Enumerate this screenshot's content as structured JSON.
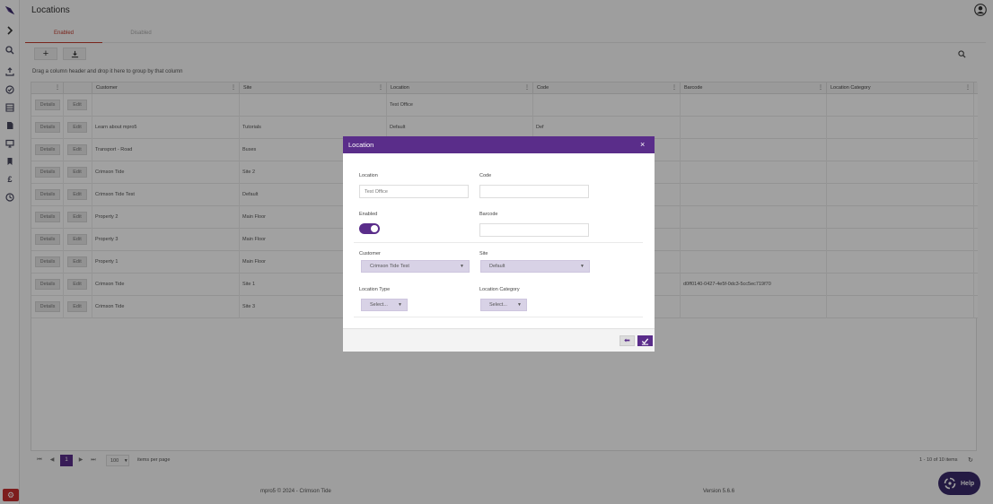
{
  "app": {
    "page_title": "Locations",
    "colors": {
      "accent": "#5a2d8a",
      "danger": "#c62f2f",
      "tab_active": "#c0392b"
    }
  },
  "sidebar": {
    "items": [
      {
        "icon": "logo-icon"
      },
      {
        "icon": "chevron-right-icon"
      },
      {
        "icon": "search-icon"
      },
      {
        "icon": "upload-icon"
      },
      {
        "icon": "check-circle-icon"
      },
      {
        "icon": "list-icon"
      },
      {
        "icon": "document-icon"
      },
      {
        "icon": "monitor-icon"
      },
      {
        "icon": "bookmark-icon"
      },
      {
        "icon": "pound-icon"
      },
      {
        "icon": "clock-icon"
      }
    ],
    "settings_icon": "gear-icon"
  },
  "tabs": [
    {
      "label": "Enabled",
      "active": true
    },
    {
      "label": "Disabled",
      "active": false
    }
  ],
  "grid": {
    "group_hint": "Drag a column header and drop it here to group by that column",
    "columns": [
      "Customer",
      "Site",
      "Location",
      "Code",
      "Barcode",
      "Location Category"
    ],
    "details_label": "Details",
    "edit_label": "Edit",
    "rows": [
      {
        "customer": "",
        "site": "",
        "location": "Test Office",
        "code": "",
        "barcode": "",
        "category": ""
      },
      {
        "customer": "Learn about mpro5",
        "site": "Tutorials",
        "location": "Default",
        "code": "Def",
        "barcode": "",
        "category": ""
      },
      {
        "customer": "Transport - Road",
        "site": "Buses",
        "location": "",
        "code": "",
        "barcode": "",
        "category": ""
      },
      {
        "customer": "Crimson Tide",
        "site": "Site 2",
        "location": "",
        "code": "",
        "barcode": "",
        "category": ""
      },
      {
        "customer": "Crimson Tide Test",
        "site": "Default",
        "location": "",
        "code": "",
        "barcode": "",
        "category": ""
      },
      {
        "customer": "Property 2",
        "site": "Main Floor",
        "location": "",
        "code": "",
        "barcode": "",
        "category": ""
      },
      {
        "customer": "Property 3",
        "site": "Main Floor",
        "location": "",
        "code": "",
        "barcode": "",
        "category": ""
      },
      {
        "customer": "Property 1",
        "site": "Main Floor",
        "location": "",
        "code": "",
        "barcode": "",
        "category": ""
      },
      {
        "customer": "Crimson Tide",
        "site": "Site 1",
        "location": "",
        "code": "",
        "barcode": "d0ff0140-0427-4e5f-0dc3-5cc5ec719f70",
        "category": ""
      },
      {
        "customer": "Crimson Tide",
        "site": "Site 3",
        "location": "",
        "code": "",
        "barcode": "",
        "category": ""
      }
    ]
  },
  "pager": {
    "current_page": "1",
    "items_per_page": "100",
    "items_per_page_label": "items per page",
    "info": "1 - 10 of 10 items"
  },
  "footer": {
    "copyright": "mpro5 © 2024 - Crimson Tide",
    "version": "Version 5.6.6"
  },
  "help": {
    "label": "Help"
  },
  "modal": {
    "title": "Location",
    "close": "×",
    "location_label": "Location",
    "location_value": "Test Office",
    "code_label": "Code",
    "code_value": "",
    "enabled_label": "Enabled",
    "enabled": true,
    "barcode_label": "Barcode",
    "barcode_value": "",
    "customer_label": "Customer",
    "customer_value": "Crimson Tide Test",
    "site_label": "Site",
    "site_value": "Default",
    "location_type_label": "Location Type",
    "location_type_value": "Select...",
    "location_category_label": "Location Category",
    "location_category_value": "Select..."
  }
}
